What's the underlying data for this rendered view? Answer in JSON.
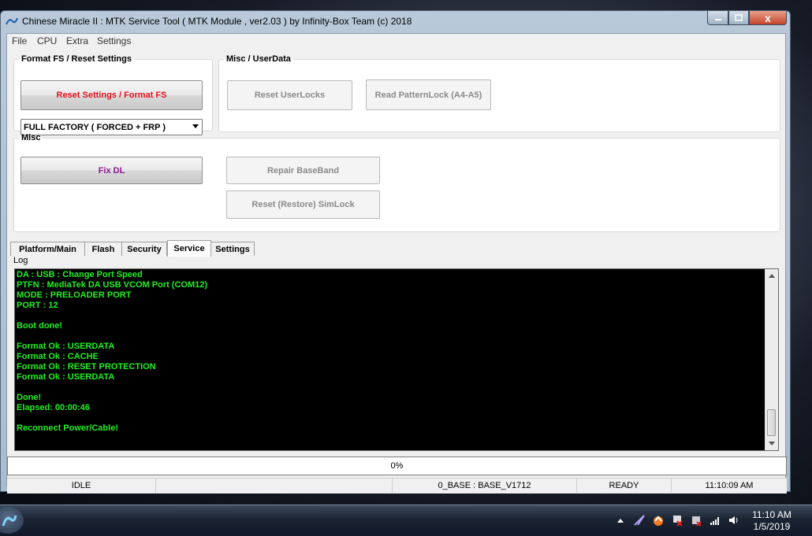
{
  "window": {
    "title": "Chinese Miracle II : MTK Service Tool ( MTK Module , ver2.03  ) by Infinity-Box Team (c) 2018",
    "close_glyph": "x"
  },
  "menu": [
    "File",
    "CPU",
    "Extra",
    "Settings"
  ],
  "groups": {
    "format": {
      "legend": "Format FS / Reset Settings",
      "reset_button": "Reset Settings / Format FS",
      "mode_select": "FULL FACTORY ( FORCED + FRP )"
    },
    "userdata": {
      "legend": "Misc  /  UserData",
      "reset_userlocks": "Reset UserLocks",
      "read_patternlock": "Read PatternLock (A4-A5)"
    },
    "misc": {
      "legend": "Misc",
      "fix_dl": "Fix DL",
      "repair_baseband": "Repair BaseBand",
      "reset_simlock": "Reset (Restore) SimLock"
    }
  },
  "tabs": [
    "Platform/Main",
    "Flash",
    "Security",
    "Service",
    "Settings"
  ],
  "active_tab": "Service",
  "log": {
    "label": "Log",
    "lines": [
      "DA : USB : Change Port Speed",
      "PTFN : MediaTek DA USB VCOM Port (COM12)",
      "MODE : PRELOADER PORT",
      "PORT : 12",
      "",
      "Boot done!",
      "",
      "Format Ok : USERDATA",
      "Format Ok : CACHE",
      "Format Ok : RESET PROTECTION",
      "Format Ok : USERDATA",
      "",
      "Done!",
      "Elapsed: 00:00:46",
      "",
      "Reconnect Power/Cable!"
    ]
  },
  "progress": {
    "text": "0%",
    "value": 0
  },
  "status": {
    "state": "IDLE",
    "empty": "",
    "base": "0_BASE : BASE_V1712",
    "ready": "READY",
    "time": "11:10:09 AM"
  },
  "taskbar": {
    "time": "11:10 AM",
    "date": "1/5/2019"
  },
  "colors": {
    "log_text": "#21f021",
    "reset_text": "#e8101a",
    "fixdl_text": "#8a1a8a"
  }
}
